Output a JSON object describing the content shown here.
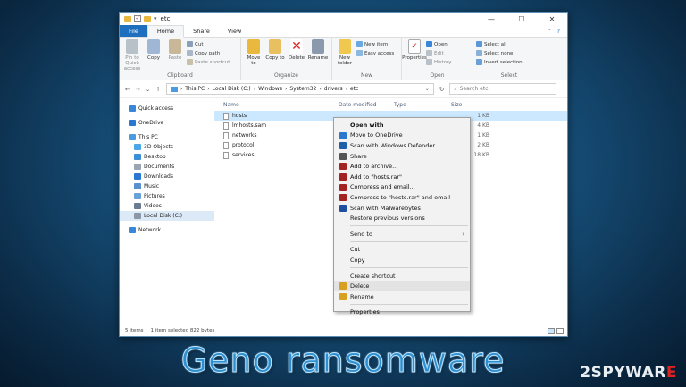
{
  "window": {
    "title": "etc",
    "controls": {
      "minimize": "—",
      "maximize": "☐",
      "close": "✕"
    }
  },
  "tabs": [
    "File",
    "Home",
    "Share",
    "View"
  ],
  "ribbon": {
    "clipboard": {
      "label": "Clipboard",
      "pin": "Pin to Quick access",
      "copy": "Copy",
      "paste": "Paste",
      "cut": "Cut",
      "copy_path": "Copy path",
      "paste_shortcut": "Paste shortcut"
    },
    "organize": {
      "label": "Organize",
      "move_to": "Move to",
      "copy_to": "Copy to",
      "delete": "Delete",
      "rename": "Rename"
    },
    "new": {
      "label": "New",
      "new_folder": "New folder",
      "new_item": "New item",
      "easy_access": "Easy access"
    },
    "open": {
      "label": "Open",
      "properties": "Properties",
      "open": "Open",
      "edit": "Edit",
      "history": "History"
    },
    "select": {
      "label": "Select",
      "select_all": "Select all",
      "select_none": "Select none",
      "invert": "Invert selection"
    }
  },
  "address": {
    "crumbs": [
      "This PC",
      "Local Disk (C:)",
      "Windows",
      "System32",
      "drivers",
      "etc"
    ],
    "search_placeholder": "Search etc"
  },
  "nav": [
    {
      "label": "Quick access",
      "color": "#3a86d8"
    },
    {
      "label": "OneDrive",
      "color": "#2b78d0"
    },
    {
      "label": "This PC",
      "color": "#4a9be0"
    },
    {
      "label": "3D Objects",
      "color": "#4aa8e8"
    },
    {
      "label": "Desktop",
      "color": "#3a8fd8"
    },
    {
      "label": "Documents",
      "color": "#9aa6b3"
    },
    {
      "label": "Downloads",
      "color": "#2b78d0"
    },
    {
      "label": "Music",
      "color": "#5a8fd0"
    },
    {
      "label": "Pictures",
      "color": "#6aa0d8"
    },
    {
      "label": "Videos",
      "color": "#6a7d90"
    },
    {
      "label": "Local Disk (C:)",
      "color": "#8a98a8"
    },
    {
      "label": "Network",
      "color": "#3a86d8"
    }
  ],
  "columns": {
    "name": "Name",
    "date": "Date modified",
    "type": "Type",
    "size": "Size"
  },
  "files": [
    {
      "name": "hosts",
      "size": "1 KB"
    },
    {
      "name": "lmhosts.sam",
      "size": "4 KB"
    },
    {
      "name": "networks",
      "size": "1 KB"
    },
    {
      "name": "protocol",
      "size": "2 KB"
    },
    {
      "name": "services",
      "size": "18 KB"
    }
  ],
  "status": {
    "items": "5 items",
    "selected": "1 item selected  822 bytes"
  },
  "context_menu": [
    {
      "label": "Open with",
      "bold": true
    },
    {
      "label": "Move to OneDrive",
      "icon": "#2b78d0"
    },
    {
      "label": "Scan with Windows Defender...",
      "icon": "#1d5fa8"
    },
    {
      "label": "Share",
      "icon": "#555555"
    },
    {
      "label": "Add to archive...",
      "icon": "#a32222"
    },
    {
      "label": "Add to \"hosts.rar\"",
      "icon": "#a32222"
    },
    {
      "label": "Compress and email...",
      "icon": "#a32222"
    },
    {
      "label": "Compress to \"hosts.rar\" and email",
      "icon": "#a32222"
    },
    {
      "label": "Scan with Malwarebytes",
      "icon": "#1f4fa0"
    },
    {
      "label": "Restore previous versions"
    },
    {
      "sep": true
    },
    {
      "label": "Send to",
      "arrow": "›"
    },
    {
      "sep": true
    },
    {
      "label": "Cut"
    },
    {
      "label": "Copy"
    },
    {
      "sep": true
    },
    {
      "label": "Create shortcut"
    },
    {
      "label": "Delete",
      "icon": "#d8a020",
      "hl": true
    },
    {
      "label": "Rename",
      "icon": "#d8a020"
    },
    {
      "sep": true
    },
    {
      "label": "Properties"
    }
  ],
  "caption": "Geno  ransomware",
  "logo": {
    "prefix": "2SPYWAR",
    "suffix": "E"
  }
}
